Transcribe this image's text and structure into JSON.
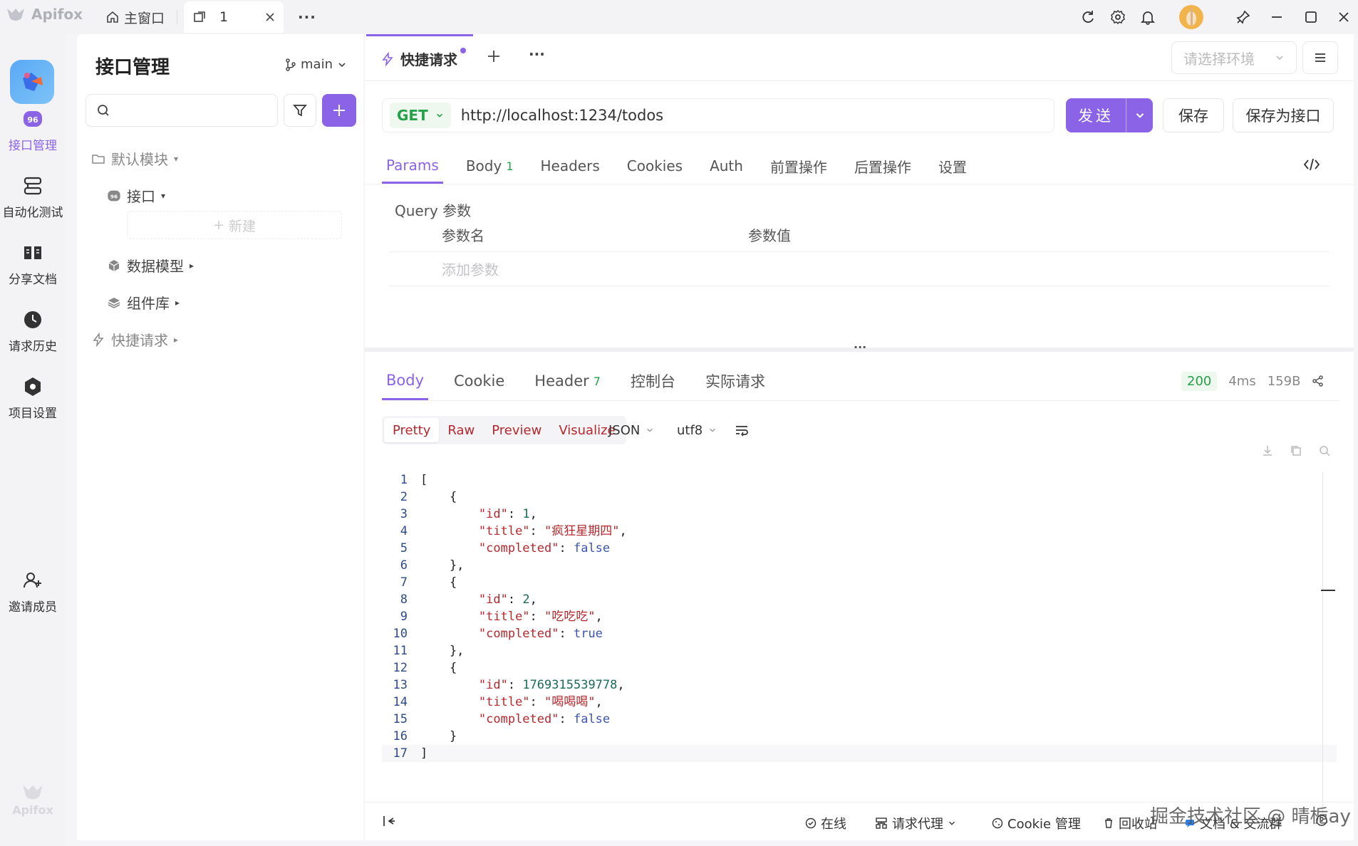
{
  "titlebar": {
    "app_name": "Apifox",
    "home_label": "主窗口",
    "tab_label": "1"
  },
  "rail": {
    "items": [
      {
        "label": "接口管理",
        "icon": "api-icon"
      },
      {
        "label": "自动化测试",
        "icon": "automation-icon"
      },
      {
        "label": "分享文档",
        "icon": "book-icon"
      },
      {
        "label": "请求历史",
        "icon": "clock-icon"
      },
      {
        "label": "项目设置",
        "icon": "hexagon-settings-icon"
      },
      {
        "label": "邀请成员",
        "icon": "user-plus-icon"
      }
    ],
    "footer_logo": "Apifox"
  },
  "sidebar": {
    "title": "接口管理",
    "branch": "main",
    "tree": {
      "default_module": "默认模块",
      "interfaces": "接口",
      "new": "新建",
      "data_models": "数据模型",
      "components": "组件库",
      "quick_request": "快捷请求"
    }
  },
  "main": {
    "tab_label": "快捷请求",
    "env_placeholder": "请选择环境",
    "method": "GET",
    "url": "http://localhost:1234/todos",
    "send_label": "发送",
    "save_label": "保存",
    "save_as_label": "保存为接口",
    "req_tabs": [
      {
        "label": "Params",
        "active": true
      },
      {
        "label": "Body",
        "badge": "1"
      },
      {
        "label": "Headers"
      },
      {
        "label": "Cookies"
      },
      {
        "label": "Auth"
      },
      {
        "label": "前置操作"
      },
      {
        "label": "后置操作"
      },
      {
        "label": "设置"
      }
    ],
    "query_title": "Query 参数",
    "col_name": "参数名",
    "col_value": "参数值",
    "add_param": "添加参数"
  },
  "response": {
    "tabs": [
      {
        "label": "Body",
        "active": true
      },
      {
        "label": "Cookie"
      },
      {
        "label": "Header",
        "badge": "7"
      },
      {
        "label": "控制台"
      },
      {
        "label": "实际请求"
      }
    ],
    "status": "200",
    "time": "4ms",
    "size": "159B",
    "formats": [
      "Pretty",
      "Raw",
      "Preview",
      "Visualize"
    ],
    "lang": "JSON",
    "encoding": "utf8",
    "body": [
      {
        "id": 1,
        "title": "疯狂星期四",
        "completed": false
      },
      {
        "id": 2,
        "title": "吃吃吃",
        "completed": true
      },
      {
        "id": 1769315539778,
        "title": "喝喝喝",
        "completed": false
      }
    ]
  },
  "footer": {
    "online": "在线",
    "proxy": "请求代理",
    "cookie": "Cookie 管理",
    "recycle": "回收站",
    "docs": "文档 & 交流群"
  },
  "watermark": "掘金技术社区 @ 晴栀ay",
  "colors": {
    "accent": "#8b63e6",
    "success": "#26a148"
  }
}
